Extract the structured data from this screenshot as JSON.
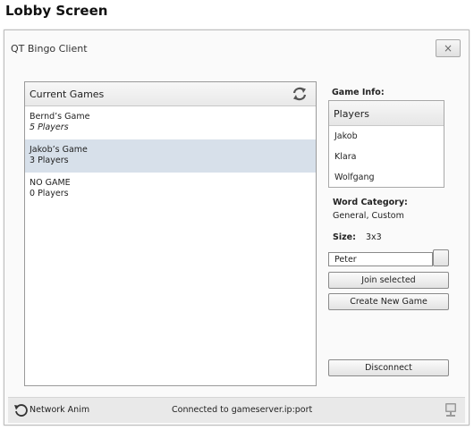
{
  "page": {
    "title": "Lobby Screen"
  },
  "window": {
    "title": "QT Bingo Client",
    "close_label": "×"
  },
  "games": {
    "header": "Current Games",
    "items": [
      {
        "name": "Bernd’s Game",
        "players": "5 Players"
      },
      {
        "name": "Jakob’s Game",
        "players": "3 Players"
      },
      {
        "name": "NO GAME",
        "players": "0 Players"
      }
    ]
  },
  "game_info": {
    "label": "Game Info:",
    "players_header": "Players",
    "players": [
      "Jakob",
      "Klara",
      "Wolfgang"
    ],
    "word_category_label": "Word Category:",
    "word_category_value": "General, Custom",
    "size_label": "Size:",
    "size_value": "3x3"
  },
  "join": {
    "name_value": "Peter",
    "join_label": "Join selected",
    "create_label": "Create New Game",
    "disconnect_label": "Disconnect"
  },
  "status": {
    "network_label": "Network Anim",
    "connection_text": "Connected to gameserver.ip:port"
  }
}
